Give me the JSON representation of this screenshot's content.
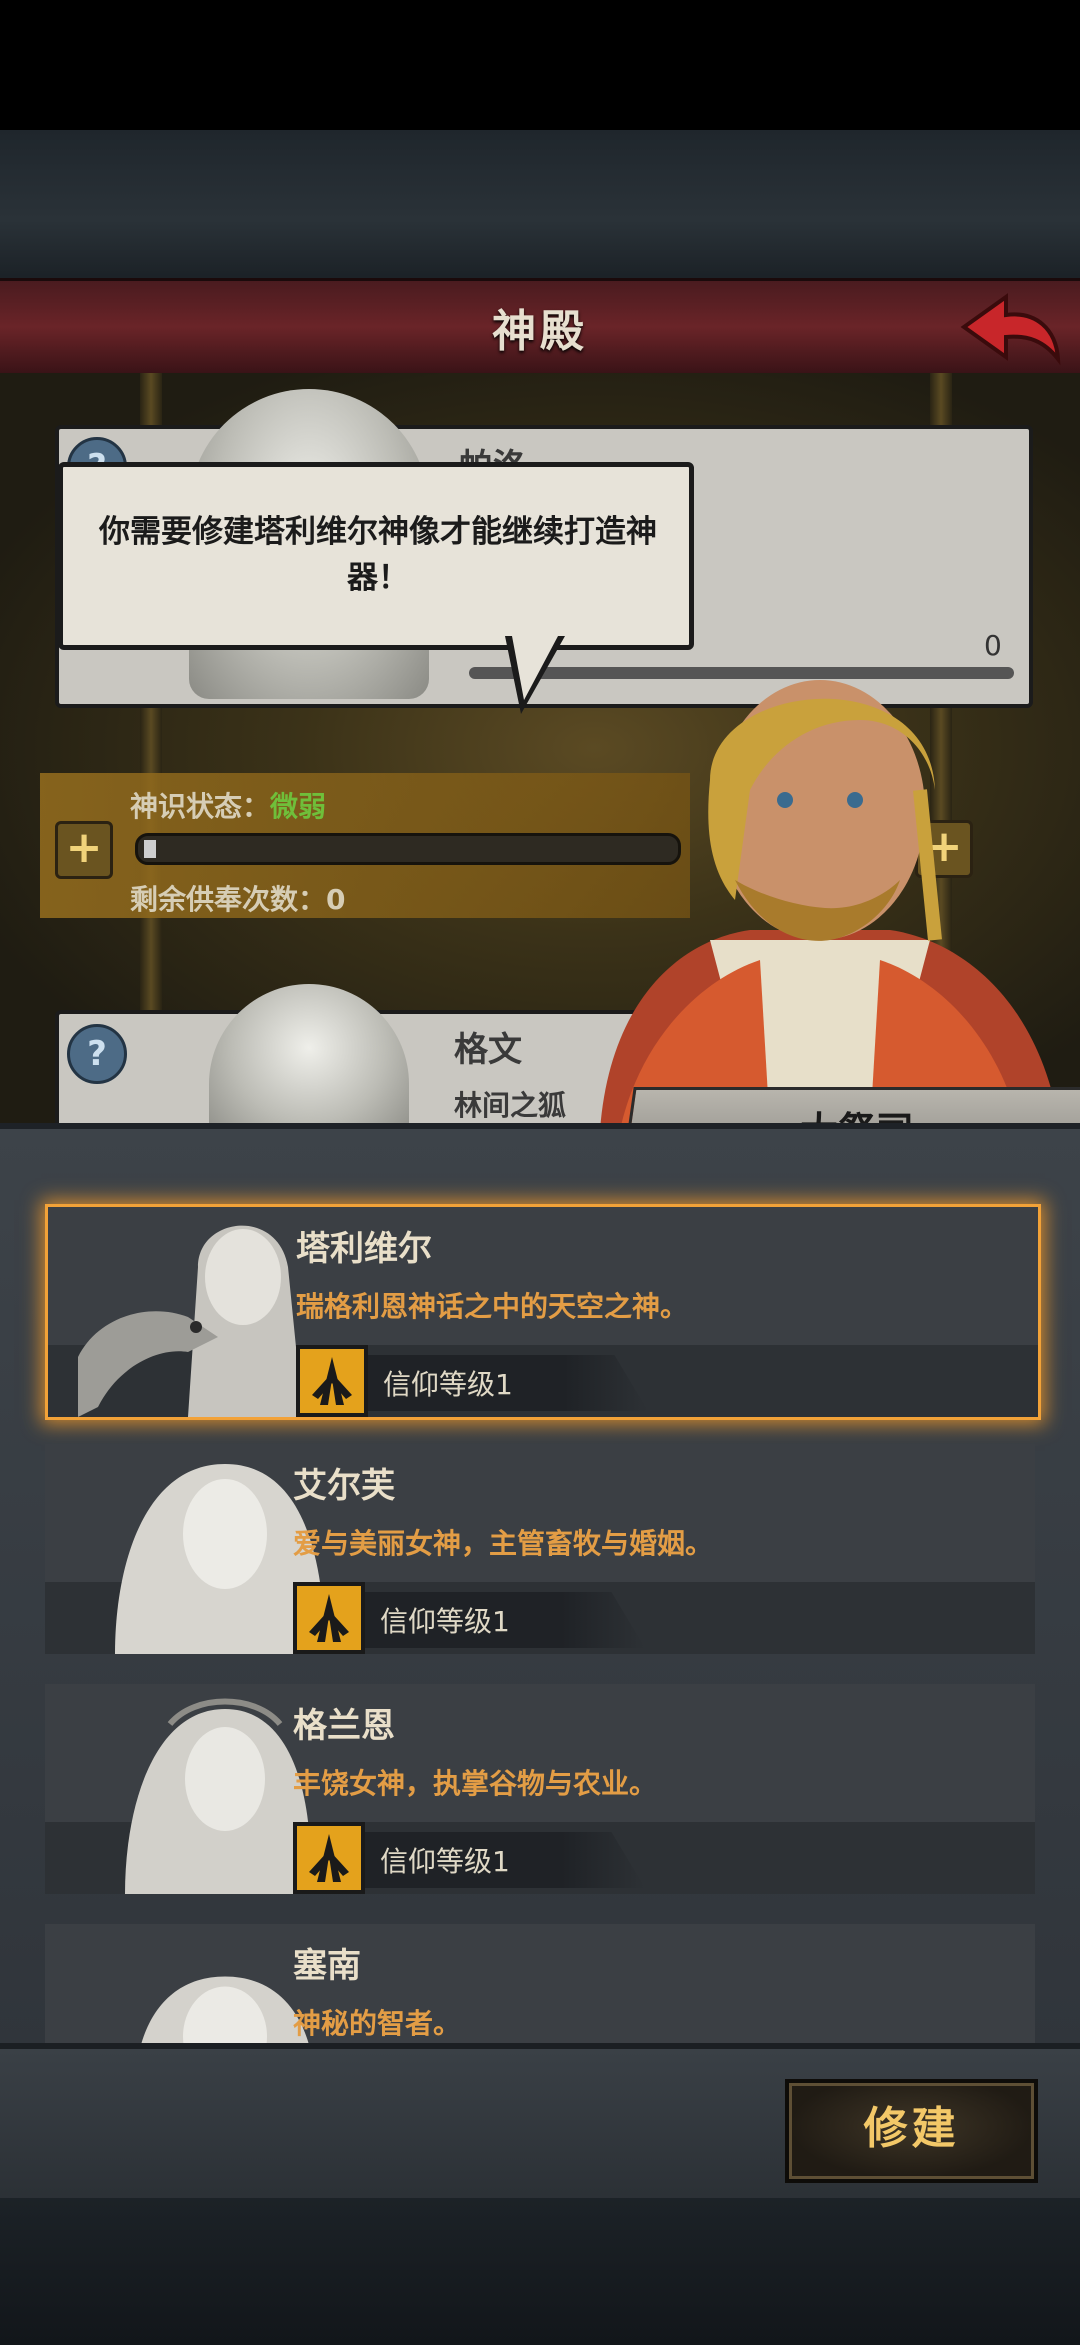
{
  "header": {
    "title": "神殿",
    "back_icon": "back-arrow-icon"
  },
  "top_card": {
    "name": "帕洛",
    "value": "0"
  },
  "speech": {
    "text": "你需要修建塔利维尔神像才能继续打造神器！"
  },
  "faith_panel": {
    "status_label": "神识状态：",
    "status_value": "微弱",
    "offerings_label": "剩余供奉次数：0",
    "offerings_count": 0,
    "status_level": 0.02
  },
  "mid_card": {
    "name": "格文",
    "sub": "林间之狐"
  },
  "npc": {
    "title": "大祭司"
  },
  "gods": [
    {
      "name": "塔利维尔",
      "desc": "瑞格利恩神话之中的天空之神。",
      "level": "信仰等级1",
      "selected": true
    },
    {
      "name": "艾尔芙",
      "desc": "爱与美丽女神，主管畜牧与婚姻。",
      "level": "信仰等级1",
      "selected": false
    },
    {
      "name": "格兰恩",
      "desc": "丰饶女神，执掌谷物与农业。",
      "level": "信仰等级1",
      "selected": false
    },
    {
      "name": "塞南",
      "desc": "神秘的智者。",
      "level": "",
      "selected": false
    }
  ],
  "actions": {
    "build": "修建"
  },
  "colors": {
    "accent": "#e39d45",
    "header": "#6a2428",
    "selected_glow": "#f2a238",
    "status_ok": "#6fbf3a"
  }
}
